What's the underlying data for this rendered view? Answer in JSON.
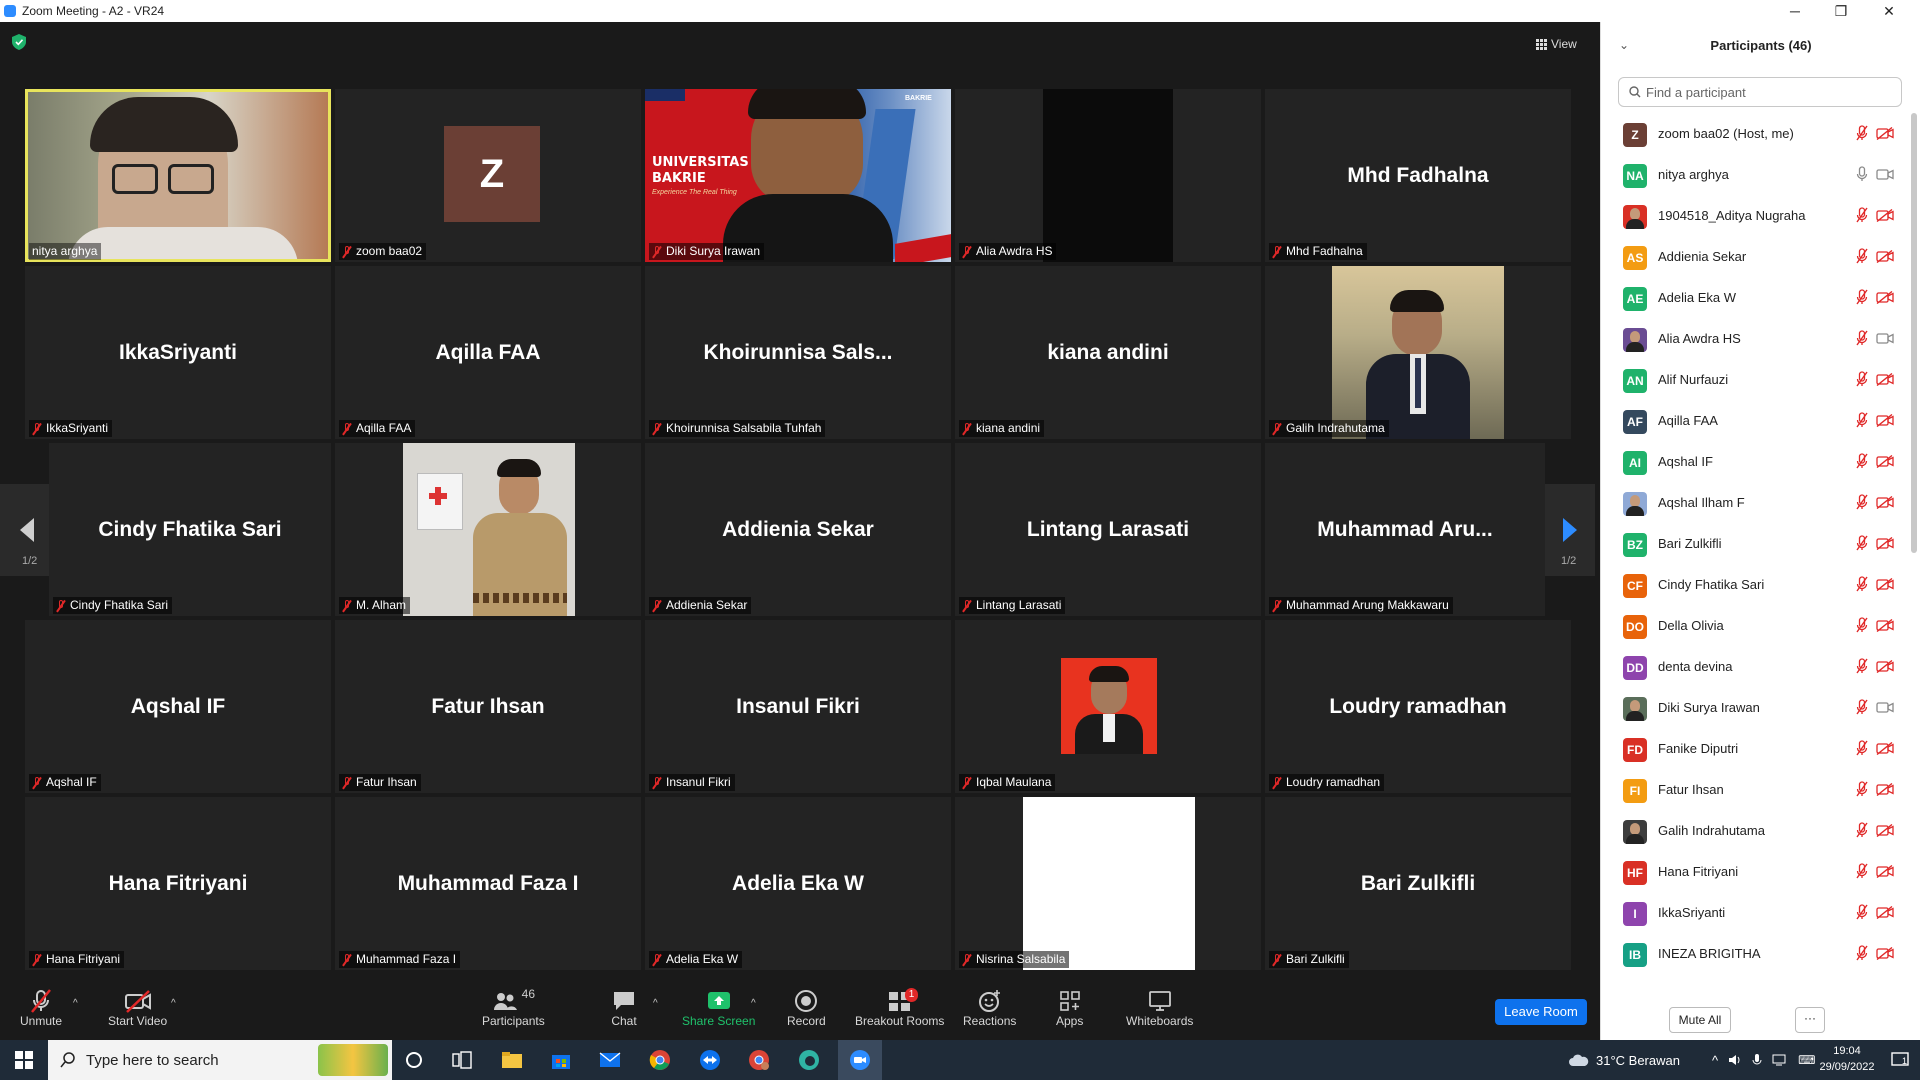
{
  "window": {
    "title": "Zoom Meeting - A2 - VR24",
    "minimize": "─",
    "maximize": "❐",
    "close": "✕"
  },
  "meeting": {
    "view_label": "View",
    "page_indicator_left": "1/2",
    "page_indicator_right": "1/2",
    "tiles": [
      {
        "label": "nitya arghya",
        "center": "",
        "kind": "video",
        "active": true
      },
      {
        "label": "zoom baa02",
        "center": "",
        "kind": "avatar",
        "avatar_letter": "Z"
      },
      {
        "label": "Diki Surya Irawan",
        "center": "",
        "kind": "video-uni",
        "banner_line1": "UNIVERSITAS",
        "banner_line2": "BAKRIE",
        "banner_line3": "Experience The Real Thing",
        "banner_corner": "BAKRIE"
      },
      {
        "label": "Alia Awdra HS",
        "center": "",
        "kind": "dark"
      },
      {
        "label": "Mhd Fadhalna",
        "center": "Mhd Fadhalna",
        "kind": "name"
      },
      {
        "label": "IkkaSriyanti",
        "center": "IkkaSriyanti",
        "kind": "name"
      },
      {
        "label": "Aqilla FAA",
        "center": "Aqilla FAA",
        "kind": "name"
      },
      {
        "label": "Khoirunnisa Salsabila Tuhfah",
        "center": "Khoirunnisa  Sals...",
        "kind": "name"
      },
      {
        "label": "kiana andini",
        "center": "kiana andini",
        "kind": "name"
      },
      {
        "label": "Galih Indrahutama",
        "center": "",
        "kind": "photo-suit"
      },
      {
        "label": "Cindy Fhatika Sari",
        "center": "Cindy Fhatika Sari",
        "kind": "name"
      },
      {
        "label": "M. Alham",
        "center": "",
        "kind": "photo-batik"
      },
      {
        "label": "Addienia Sekar",
        "center": "Addienia Sekar",
        "kind": "name"
      },
      {
        "label": "Lintang Larasati",
        "center": "Lintang Larasati",
        "kind": "name"
      },
      {
        "label": "Muhammad Arung Makkawaru",
        "center": "Muhammad  Aru...",
        "kind": "name"
      },
      {
        "label": "Aqshal IF",
        "center": "Aqshal IF",
        "kind": "name"
      },
      {
        "label": "Fatur Ihsan",
        "center": "Fatur Ihsan",
        "kind": "name"
      },
      {
        "label": "Insanul Fikri",
        "center": "Insanul Fikri",
        "kind": "name"
      },
      {
        "label": "Iqbal Maulana",
        "center": "",
        "kind": "photo-red"
      },
      {
        "label": "Loudry ramadhan",
        "center": "Loudry ramadhan",
        "kind": "name"
      },
      {
        "label": "Hana Fitriyani",
        "center": "Hana Fitriyani",
        "kind": "name"
      },
      {
        "label": "Muhammad Faza I",
        "center": "Muhammad Faza I",
        "kind": "name"
      },
      {
        "label": "Adelia Eka W",
        "center": "Adelia Eka W",
        "kind": "name"
      },
      {
        "label": "Nisrina Salsabila",
        "center": "",
        "kind": "white"
      },
      {
        "label": "Bari Zulkifli",
        "center": "Bari Zulkifli",
        "kind": "name"
      }
    ]
  },
  "toolbar": {
    "unmute": "Unmute",
    "start_video": "Start Video",
    "participants": "Participants",
    "participants_count": "46",
    "chat": "Chat",
    "share_screen": "Share Screen",
    "record": "Record",
    "breakout_rooms": "Breakout Rooms",
    "breakout_badge": "1",
    "reactions": "Reactions",
    "apps": "Apps",
    "whiteboards": "Whiteboards",
    "leave_room": "Leave Room"
  },
  "sidebar": {
    "title": "Participants (46)",
    "search_placeholder": "Find a participant",
    "mute_all": "Mute All",
    "more": "···",
    "participants": [
      {
        "initials": "Z",
        "color": "#6b3f35",
        "name": "zoom baa02 (Host, me)",
        "mic": "muted",
        "cam": "off"
      },
      {
        "initials": "NA",
        "color": "#1fb26b",
        "name": "nitya arghya",
        "mic": "on",
        "cam": "on"
      },
      {
        "initials": "",
        "color": "#d93025",
        "name": "1904518_Aditya Nugraha",
        "mic": "muted",
        "cam": "off",
        "photo": true
      },
      {
        "initials": "AS",
        "color": "#f39c12",
        "name": "Addienia Sekar",
        "mic": "muted",
        "cam": "off"
      },
      {
        "initials": "AE",
        "color": "#1fb26b",
        "name": "Adelia Eka W",
        "mic": "muted",
        "cam": "off"
      },
      {
        "initials": "",
        "color": "#6a4c93",
        "name": "Alia Awdra HS",
        "mic": "muted",
        "cam": "on",
        "photo": true
      },
      {
        "initials": "AN",
        "color": "#1fb26b",
        "name": "Alif Nurfauzi",
        "mic": "muted",
        "cam": "off"
      },
      {
        "initials": "AF",
        "color": "#34495e",
        "name": "Aqilla FAA",
        "mic": "muted",
        "cam": "off"
      },
      {
        "initials": "AI",
        "color": "#1fb26b",
        "name": "Aqshal IF",
        "mic": "muted",
        "cam": "off"
      },
      {
        "initials": "",
        "color": "#8fa9d6",
        "name": "Aqshal Ilham F",
        "mic": "muted",
        "cam": "off",
        "photo": true
      },
      {
        "initials": "BZ",
        "color": "#1fb26b",
        "name": "Bari Zulkifli",
        "mic": "muted",
        "cam": "off"
      },
      {
        "initials": "CF",
        "color": "#e8630a",
        "name": "Cindy Fhatika Sari",
        "mic": "muted",
        "cam": "off"
      },
      {
        "initials": "DO",
        "color": "#e8630a",
        "name": "Della Olivia",
        "mic": "muted",
        "cam": "off"
      },
      {
        "initials": "DD",
        "color": "#8e44ad",
        "name": "denta devina",
        "mic": "muted",
        "cam": "off"
      },
      {
        "initials": "",
        "color": "#5a6e5a",
        "name": "Diki Surya Irawan",
        "mic": "muted",
        "cam": "on",
        "photo": true
      },
      {
        "initials": "FD",
        "color": "#d93025",
        "name": "Fanike Diputri",
        "mic": "muted",
        "cam": "off"
      },
      {
        "initials": "FI",
        "color": "#f39c12",
        "name": "Fatur Ihsan",
        "mic": "muted",
        "cam": "off"
      },
      {
        "initials": "",
        "color": "#3d3d3d",
        "name": "Galih Indrahutama",
        "mic": "muted",
        "cam": "off",
        "photo": true
      },
      {
        "initials": "HF",
        "color": "#d93025",
        "name": "Hana Fitriyani",
        "mic": "muted",
        "cam": "off"
      },
      {
        "initials": "I",
        "color": "#8e44ad",
        "name": "IkkaSriyanti",
        "mic": "muted",
        "cam": "off"
      },
      {
        "initials": "IB",
        "color": "#16a085",
        "name": "INEZA BRIGITHA",
        "mic": "muted",
        "cam": "off"
      }
    ]
  },
  "taskbar": {
    "search_placeholder": "Type here to search",
    "weather": "31°C Berawan",
    "time": "19:04",
    "date": "29/09/2022",
    "notif_count": "1"
  },
  "colors": {
    "meeting_bg": "#1a1a1a",
    "tile_bg": "#232323",
    "active_border": "#e8e45c",
    "leave_blue": "#0e72ed",
    "muted_red": "#e02828",
    "share_green": "#1fc16b"
  }
}
